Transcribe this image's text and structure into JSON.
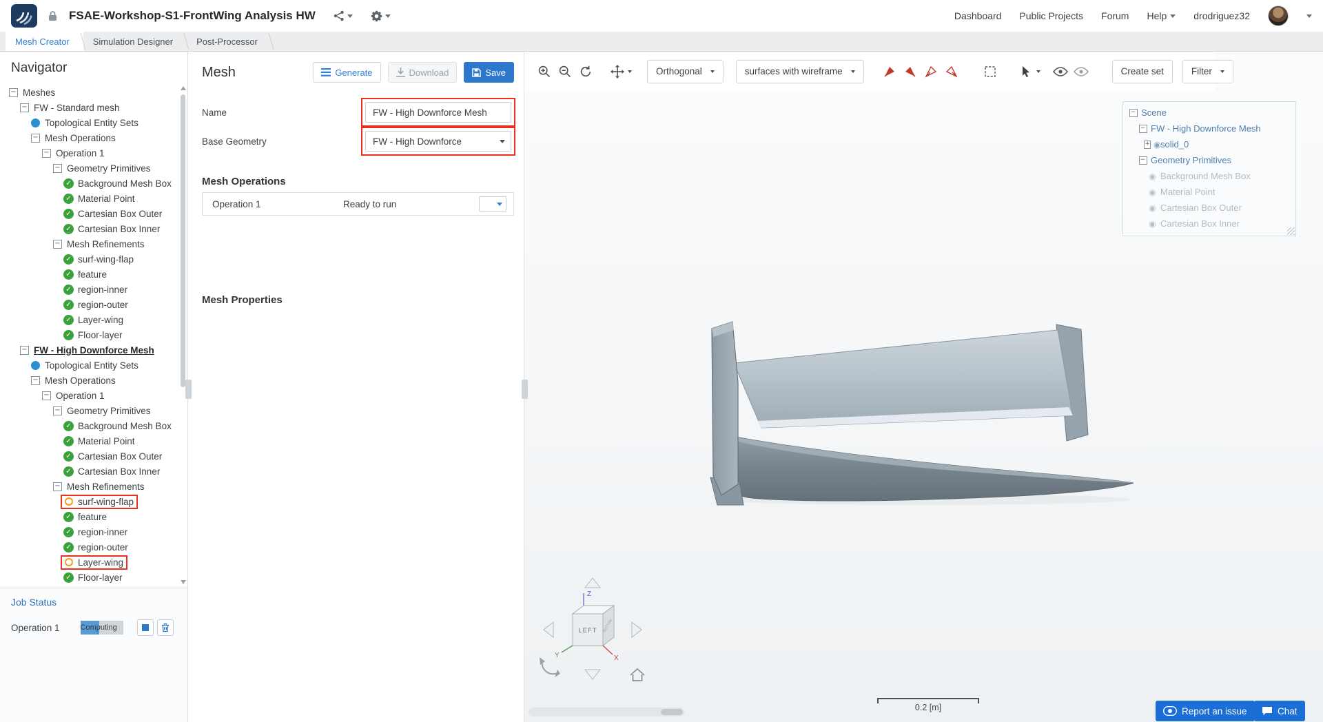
{
  "colors": {
    "accent_blue": "#2f7fd6",
    "save_button_blue": "#2e78cb",
    "highlight_red": "#ea2f1f",
    "check_green": "#3ba23b",
    "pending_orange": "#f59a23",
    "progress_blue": "#5b9bd5",
    "scene_tree_blue": "#4f80ad",
    "scene_tree_muted": "#b3bbc1"
  },
  "topbar": {
    "project_title": "FSAE-Workshop-S1-FrontWing Analysis HW",
    "nav": [
      {
        "label": "Dashboard"
      },
      {
        "label": "Public Projects"
      },
      {
        "label": "Forum"
      },
      {
        "label": "Help"
      }
    ],
    "username": "drodriguez32"
  },
  "tabs": [
    {
      "label": "Mesh Creator",
      "active": true
    },
    {
      "label": "Simulation Designer"
    },
    {
      "label": "Post-Processor"
    }
  ],
  "navigator": {
    "title": "Navigator",
    "tree": [
      {
        "label": "Meshes",
        "depth": 0,
        "icon": "collapse"
      },
      {
        "label": "FW - Standard mesh",
        "depth": 1,
        "icon": "collapse"
      },
      {
        "label": "Topological Entity Sets",
        "depth": 2,
        "icon": "dot"
      },
      {
        "label": "Mesh Operations",
        "depth": 2,
        "icon": "collapse"
      },
      {
        "label": "Operation 1",
        "depth": 3,
        "icon": "collapse"
      },
      {
        "label": "Geometry Primitives",
        "depth": 4,
        "icon": "collapse"
      },
      {
        "label": "Background Mesh Box",
        "depth": 5,
        "icon": "check"
      },
      {
        "label": "Material Point",
        "depth": 5,
        "icon": "check"
      },
      {
        "label": "Cartesian Box Outer",
        "depth": 5,
        "icon": "check"
      },
      {
        "label": "Cartesian Box Inner",
        "depth": 5,
        "icon": "check"
      },
      {
        "label": "Mesh Refinements",
        "depth": 4,
        "icon": "collapse"
      },
      {
        "label": "surf-wing-flap",
        "depth": 5,
        "icon": "check"
      },
      {
        "label": "feature",
        "depth": 5,
        "icon": "check"
      },
      {
        "label": "region-inner",
        "depth": 5,
        "icon": "check"
      },
      {
        "label": "region-outer",
        "depth": 5,
        "icon": "check"
      },
      {
        "label": "Layer-wing",
        "depth": 5,
        "icon": "check"
      },
      {
        "label": "Floor-layer",
        "depth": 5,
        "icon": "check"
      },
      {
        "label": "FW - High Downforce Mesh",
        "depth": 1,
        "icon": "collapse",
        "selected": true
      },
      {
        "label": "Topological Entity Sets",
        "depth": 2,
        "icon": "dot"
      },
      {
        "label": "Mesh Operations",
        "depth": 2,
        "icon": "collapse"
      },
      {
        "label": "Operation 1",
        "depth": 3,
        "icon": "collapse"
      },
      {
        "label": "Geometry Primitives",
        "depth": 4,
        "icon": "collapse"
      },
      {
        "label": "Background Mesh Box",
        "depth": 5,
        "icon": "check"
      },
      {
        "label": "Material Point",
        "depth": 5,
        "icon": "check"
      },
      {
        "label": "Cartesian Box Outer",
        "depth": 5,
        "icon": "check"
      },
      {
        "label": "Cartesian Box Inner",
        "depth": 5,
        "icon": "check"
      },
      {
        "label": "Mesh Refinements",
        "depth": 4,
        "icon": "collapse"
      },
      {
        "label": "surf-wing-flap",
        "depth": 5,
        "icon": "pending",
        "redbox": true
      },
      {
        "label": "feature",
        "depth": 5,
        "icon": "check"
      },
      {
        "label": "region-inner",
        "depth": 5,
        "icon": "check"
      },
      {
        "label": "region-outer",
        "depth": 5,
        "icon": "check"
      },
      {
        "label": "Layer-wing",
        "depth": 5,
        "icon": "pending",
        "redbox": true
      },
      {
        "label": "Floor-layer",
        "depth": 5,
        "icon": "check"
      }
    ]
  },
  "job_status": {
    "title": "Job Status",
    "job_name": "Operation 1",
    "job_state": "Computing",
    "progress_percent": 45
  },
  "mesh_panel": {
    "title": "Mesh",
    "generate_label": "Generate",
    "download_label": "Download",
    "save_label": "Save",
    "name_label": "Name",
    "name_value": "FW - High Downforce Mesh",
    "base_geometry_label": "Base Geometry",
    "base_geometry_value": "FW - High Downforce",
    "operations_title": "Mesh Operations",
    "operations": [
      {
        "name": "Operation 1",
        "status": "Ready to run"
      }
    ],
    "properties_title": "Mesh Properties"
  },
  "viewport": {
    "projection_mode": "Orthogonal",
    "render_mode": "surfaces with wireframe",
    "create_set_label": "Create set",
    "filter_label": "Filter",
    "scene_tree": [
      {
        "label": "Scene",
        "depth": 0,
        "icon": "collapse",
        "tone": "blue"
      },
      {
        "label": "FW - High Downforce Mesh",
        "depth": 1,
        "icon": "collapse",
        "tone": "blue"
      },
      {
        "label": "solid_0",
        "depth": 2,
        "icon": "expand-eye",
        "tone": "blue"
      },
      {
        "label": "Geometry Primitives",
        "depth": 1,
        "icon": "collapse",
        "tone": "blue"
      },
      {
        "label": "Background Mesh Box",
        "depth": 2,
        "icon": "eye",
        "tone": "muted"
      },
      {
        "label": "Material Point",
        "depth": 2,
        "icon": "eye",
        "tone": "muted"
      },
      {
        "label": "Cartesian Box Outer",
        "depth": 2,
        "icon": "eye",
        "tone": "muted"
      },
      {
        "label": "Cartesian Box Inner",
        "depth": 2,
        "icon": "eye",
        "tone": "muted"
      }
    ],
    "nav_cube": {
      "face_label": "LEFT",
      "side_label": "BOTTOM",
      "x_label": "X",
      "y_label": "Y",
      "z_label": "Z"
    },
    "scale_bar_label": "0.2 [m]",
    "report_issue_label": "Report an issue",
    "chat_label": "Chat"
  }
}
